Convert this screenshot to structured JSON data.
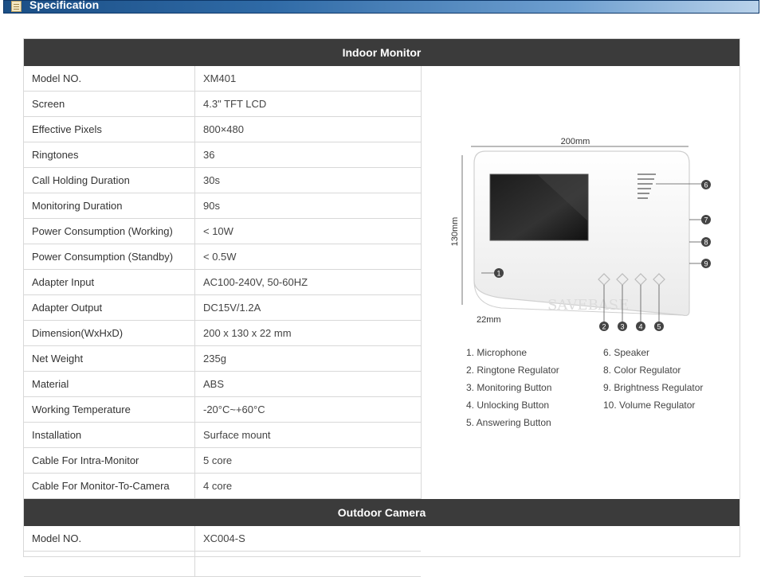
{
  "banner": {
    "title": "Specification"
  },
  "indoor": {
    "title": "Indoor Monitor",
    "rows": [
      {
        "label": "Model NO.",
        "value": "XM401"
      },
      {
        "label": "Screen",
        "value": "4.3\" TFT LCD"
      },
      {
        "label": "Effective Pixels",
        "value": "800×480"
      },
      {
        "label": "Ringtones",
        "value": "36"
      },
      {
        "label": "Call Holding Duration",
        "value": "30s"
      },
      {
        "label": "Monitoring Duration",
        "value": "90s"
      },
      {
        "label": "Power Consumption (Working)",
        "value": "< 10W"
      },
      {
        "label": "Power Consumption (Standby)",
        "value": "< 0.5W"
      },
      {
        "label": "Adapter Input",
        "value": "AC100-240V, 50-60HZ"
      },
      {
        "label": "Adapter Output",
        "value": "DC15V/1.2A"
      },
      {
        "label": "Dimension(WxHxD)",
        "value": "200 x 130 x 22 mm"
      },
      {
        "label": "Net Weight",
        "value": "235g"
      },
      {
        "label": "Material",
        "value": "ABS"
      },
      {
        "label": "Working Temperature",
        "value": "-20°C~+60°C"
      },
      {
        "label": "Installation",
        "value": "Surface mount"
      },
      {
        "label": "Cable For Intra-Monitor",
        "value": "5 core"
      },
      {
        "label": "Cable For Monitor-To-Camera",
        "value": "4 core"
      }
    ]
  },
  "outdoor": {
    "title": "Outdoor Camera",
    "rows": [
      {
        "label": "Model NO.",
        "value": "XC004-S"
      }
    ]
  },
  "diagram": {
    "width_label": "200mm",
    "height_label": "130mm",
    "depth_label": "22mm",
    "watermark": "SAVEBASE",
    "callouts": [
      "1",
      "2",
      "3",
      "4",
      "5",
      "6",
      "7",
      "8",
      "9"
    ],
    "legend_left": [
      "1. Microphone",
      "2. Ringtone Regulator",
      "3. Monitoring Button",
      "4. Unlocking Button",
      "5. Answering Button"
    ],
    "legend_right": [
      "6. Speaker",
      "8. Color Regulator",
      "9. Brightness Regulator",
      "10. Volume Regulator"
    ]
  }
}
